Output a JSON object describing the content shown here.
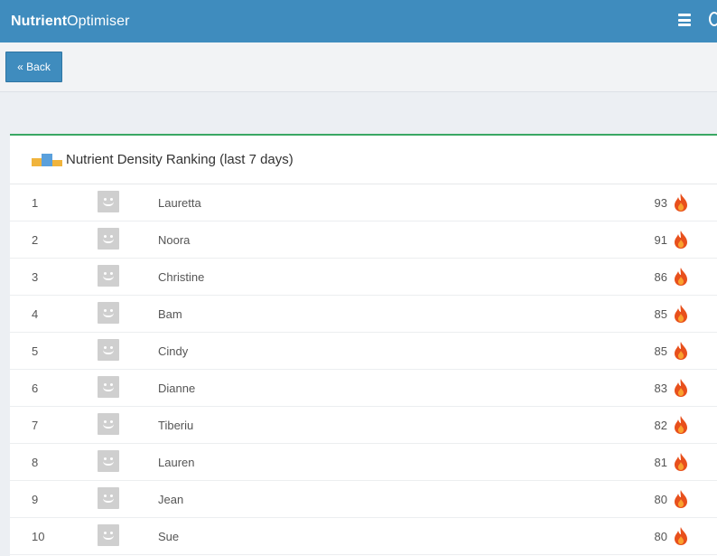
{
  "app": {
    "brand_bold": "Nutrient",
    "brand_rest": "Optimiser"
  },
  "nav": {
    "back_label": "« Back"
  },
  "panel": {
    "title": "Nutrient Density Ranking (last 7 days)"
  },
  "colors": {
    "header": "#3f8cbe",
    "panel_accent": "#3aa864",
    "flame": "#e8501c"
  },
  "icons": {
    "menu": "menu-icon",
    "podium": "podium-icon",
    "avatar": "avatar-icon",
    "score": "flame-icon"
  },
  "ranking": [
    {
      "rank": "1",
      "name": "Lauretta",
      "score": "93"
    },
    {
      "rank": "2",
      "name": "Noora",
      "score": "91"
    },
    {
      "rank": "3",
      "name": "Christine",
      "score": "86"
    },
    {
      "rank": "4",
      "name": "Bam",
      "score": "85"
    },
    {
      "rank": "5",
      "name": "Cindy",
      "score": "85"
    },
    {
      "rank": "6",
      "name": "Dianne",
      "score": "83"
    },
    {
      "rank": "7",
      "name": "Tiberiu",
      "score": "82"
    },
    {
      "rank": "8",
      "name": "Lauren",
      "score": "81"
    },
    {
      "rank": "9",
      "name": "Jean",
      "score": "80"
    },
    {
      "rank": "10",
      "name": "Sue",
      "score": "80"
    }
  ]
}
